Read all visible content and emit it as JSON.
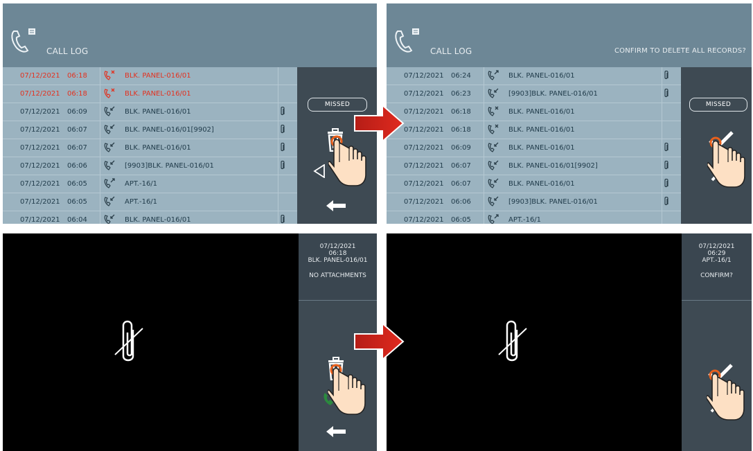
{
  "panel1": {
    "title": "CALL LOG",
    "missed_label": "MISSED",
    "rows": [
      {
        "date": "07/12/2021",
        "time": "06:18",
        "name": "BLK. PANEL-016/01",
        "missed": true,
        "type": "missed",
        "clip": false
      },
      {
        "date": "07/12/2021",
        "time": "06:18",
        "name": "BLK. PANEL-016/01",
        "missed": true,
        "type": "missed",
        "clip": false
      },
      {
        "date": "07/12/2021",
        "time": "06:09",
        "name": "BLK. PANEL-016/01",
        "missed": false,
        "type": "incoming",
        "clip": true
      },
      {
        "date": "07/12/2021",
        "time": "06:07",
        "name": "BLK. PANEL-016/01[9902]",
        "missed": false,
        "type": "incoming",
        "clip": true
      },
      {
        "date": "07/12/2021",
        "time": "06:07",
        "name": "BLK. PANEL-016/01",
        "missed": false,
        "type": "incoming",
        "clip": true
      },
      {
        "date": "07/12/2021",
        "time": "06:06",
        "name": "[9903]BLK. PANEL-016/01",
        "missed": false,
        "type": "incoming",
        "clip": true
      },
      {
        "date": "07/12/2021",
        "time": "06:05",
        "name": "APT.-16/1",
        "missed": false,
        "type": "outgoing",
        "clip": false
      },
      {
        "date": "07/12/2021",
        "time": "06:05",
        "name": "APT.-16/1",
        "missed": false,
        "type": "incoming",
        "clip": false
      },
      {
        "date": "07/12/2021",
        "time": "06:04",
        "name": "BLK. PANEL-016/01",
        "missed": false,
        "type": "incoming",
        "clip": true
      }
    ]
  },
  "panel2": {
    "title": "CALL LOG",
    "confirm_text": "CONFIRM TO DELETE ALL RECORDS?",
    "missed_label": "MISSED",
    "rows": [
      {
        "date": "07/12/2021",
        "time": "06:24",
        "name": "BLK. PANEL-016/01",
        "missed": false,
        "type": "outgoing",
        "clip": true
      },
      {
        "date": "07/12/2021",
        "time": "06:23",
        "name": "[9903]BLK. PANEL-016/01",
        "missed": false,
        "type": "incoming",
        "clip": true
      },
      {
        "date": "07/12/2021",
        "time": "06:18",
        "name": "BLK. PANEL-016/01",
        "missed": false,
        "type": "missed",
        "clip": false
      },
      {
        "date": "07/12/2021",
        "time": "06:18",
        "name": "BLK. PANEL-016/01",
        "missed": false,
        "type": "missed",
        "clip": false
      },
      {
        "date": "07/12/2021",
        "time": "06:09",
        "name": "BLK. PANEL-016/01",
        "missed": false,
        "type": "incoming",
        "clip": true
      },
      {
        "date": "07/12/2021",
        "time": "06:07",
        "name": "BLK. PANEL-016/01[9902]",
        "missed": false,
        "type": "incoming",
        "clip": true
      },
      {
        "date": "07/12/2021",
        "time": "06:07",
        "name": "BLK. PANEL-016/01",
        "missed": false,
        "type": "incoming",
        "clip": true
      },
      {
        "date": "07/12/2021",
        "time": "06:06",
        "name": "[9903]BLK. PANEL-016/01",
        "missed": false,
        "type": "incoming",
        "clip": true
      },
      {
        "date": "07/12/2021",
        "time": "06:05",
        "name": "APT.-16/1",
        "missed": false,
        "type": "outgoing",
        "clip": false
      }
    ]
  },
  "panel3": {
    "date": "07/12/2021",
    "time": "06:18",
    "name": "BLK. PANEL-016/01",
    "status": "NO ATTACHMENTS"
  },
  "panel4": {
    "date": "07/12/2021",
    "time": "06:29",
    "name": "APT.-16/1",
    "status": "CONFIRM?"
  },
  "colors": {
    "header": "#6d8796",
    "list": "#9bb3c0",
    "sidebar": "#3e4a53",
    "missed_text": "#e3311f",
    "arrow": "#d42a21"
  },
  "icons": [
    "phone-memo-icon",
    "call-type-icon",
    "paperclip-icon",
    "trash-icon",
    "back-triangle-icon",
    "back-arrow-icon",
    "check-icon",
    "cancel-x-icon",
    "hand-pointer-icon",
    "no-attachment-icon",
    "flow-arrow-icon"
  ]
}
